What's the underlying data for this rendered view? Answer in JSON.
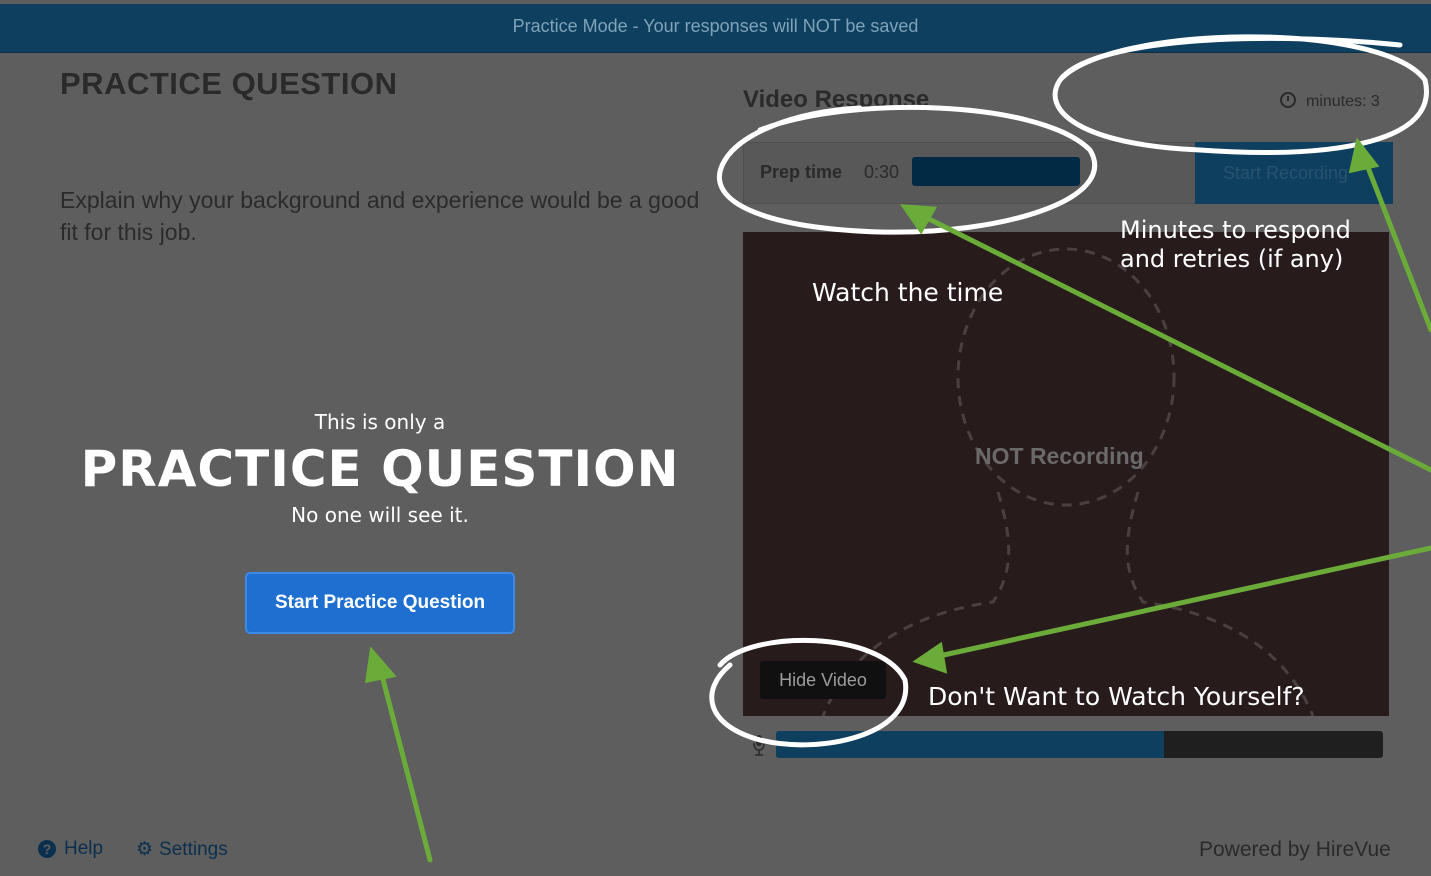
{
  "banner": {
    "text": "Practice Mode - Your responses will NOT be saved"
  },
  "question": {
    "heading": "PRACTICE QUESTION",
    "text": "Explain why your background and experience would be a good fit for this job."
  },
  "practice_overlay": {
    "line1": "This is only a",
    "line2": "PRACTICE QUESTION",
    "line3": "No one will see it."
  },
  "start_button": {
    "label": "Start Practice Question"
  },
  "video_panel": {
    "title": "Video Response",
    "minutes_label": "minutes: 3",
    "prep_label": "Prep time",
    "prep_time": "0:30",
    "record_button": "Start Recording",
    "status_text": "NOT Recording",
    "hide_video_button": "Hide Video",
    "audio_level": 0.64
  },
  "footer": {
    "help": "Help",
    "settings": "Settings",
    "powered_by": "Powered by HireVue"
  },
  "annotations": {
    "watch_time": "Watch the time",
    "minutes_note_line1": "Minutes to respond",
    "minutes_note_line2": "and retries (if any)",
    "hide_note": "Don't Want to Watch Yourself?"
  },
  "colors": {
    "banner": "#0e3f5e",
    "backdrop": "#5e5e5e",
    "primary_button": "#1f6fd1",
    "annotation_arrow": "#6aab3a"
  },
  "icons": [
    "clock-icon",
    "mic-icon",
    "help-icon",
    "gear-icon"
  ]
}
